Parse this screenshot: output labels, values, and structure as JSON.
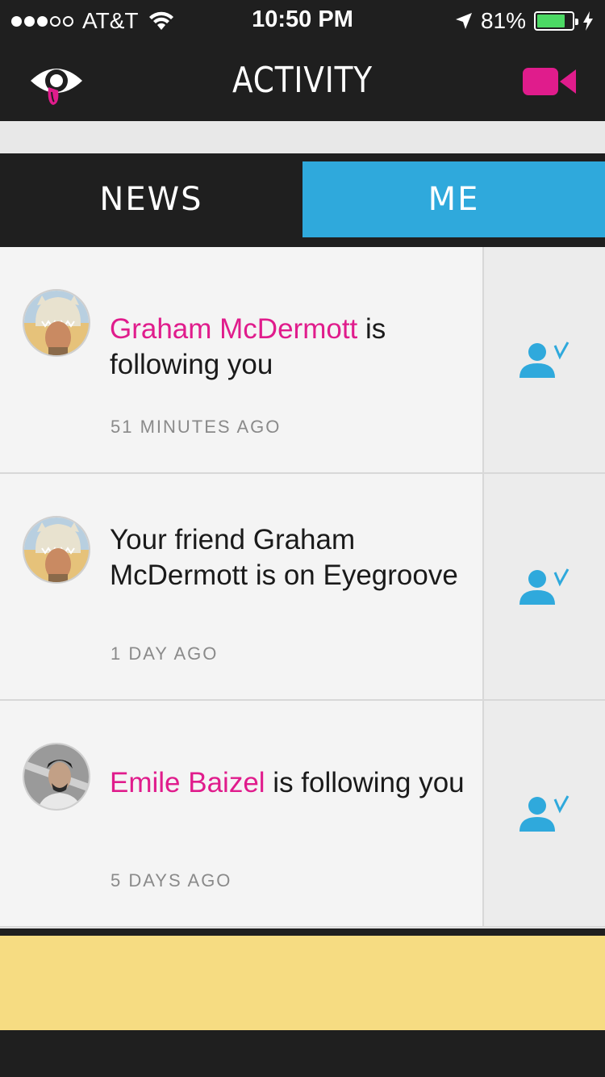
{
  "status_bar": {
    "carrier": "AT&T",
    "time": "10:50 PM",
    "battery_percent": "81%",
    "battery_level": 0.81
  },
  "nav": {
    "title": "ACTIVITY"
  },
  "tabs": [
    {
      "label": "NEWS",
      "active": false
    },
    {
      "label": "ME",
      "active": true
    }
  ],
  "colors": {
    "accent_pink": "#e01c8c",
    "accent_blue": "#2fa9dc",
    "background": "#1f1f1f"
  },
  "activity": [
    {
      "name": "Graham McDermott",
      "text": " is following you",
      "time": "51 MINUTES AGO"
    },
    {
      "prefix": "Your friend Graham McDermott is on Eyegroove",
      "time": "1 DAY AGO"
    },
    {
      "name": "Emile Baizel",
      "text": " is following you",
      "time": "5 DAYS AGO"
    }
  ],
  "icons": {
    "logo": "eyegroove-logo",
    "camera": "video-camera-icon",
    "follow": "follow-check-icon"
  }
}
